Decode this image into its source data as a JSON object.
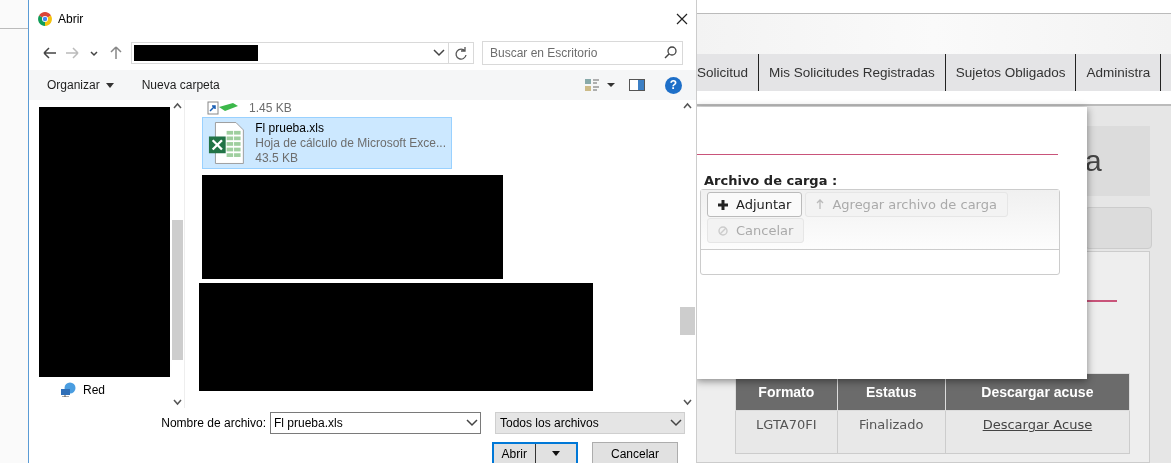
{
  "dialog": {
    "title": "Abrir",
    "search": {
      "placeholder": "Buscar en Escritorio"
    },
    "toolbar": [
      {
        "label": "Organizar",
        "kind": "menu"
      },
      {
        "label": "Nueva carpeta",
        "kind": "button"
      }
    ],
    "help": "?",
    "nav_pane": {
      "items": [
        {
          "label": "Red"
        }
      ]
    },
    "files": [
      {
        "kind": "shortcut",
        "size": "1.45 KB",
        "selected": false
      },
      {
        "kind": "excel",
        "name": "Fl prueba.xls",
        "type": "Hoja de cálculo de Microsoft Exce...",
        "size": "43.5 KB",
        "selected": true
      }
    ],
    "file_name_label": "Nombre de archivo:",
    "file_name": "Fl prueba.xls",
    "file_type": "Todos los archivos",
    "buttons": [
      {
        "label": "Abrir",
        "kind": "split"
      },
      {
        "label": "Cancelar",
        "kind": "plain"
      }
    ]
  },
  "page": {
    "nav_tabs": [
      "Solicitud",
      "Mis Solicitudes Registradas",
      "Sujetos Obligados",
      "Administra"
    ],
    "title_fragment": "a",
    "table": {
      "columns": [
        "Formato",
        "Estatus",
        "Descargar acuse"
      ],
      "rows": [
        {
          "cells": [
            {
              "text": "LGTA70FI",
              "kind": "text"
            },
            {
              "text": "Finalizado",
              "kind": "text"
            },
            {
              "text": "Descargar Acuse",
              "kind": "link"
            }
          ]
        }
      ]
    },
    "modal": {
      "label": "Archivo de carga :",
      "buttons": [
        {
          "label": "Adjuntar",
          "kind": "plus",
          "disabled": false
        },
        {
          "label": "Agregar archivo de carga",
          "kind": "upload",
          "disabled": true
        },
        {
          "label": "Cancelar",
          "kind": "ban",
          "disabled": true
        }
      ]
    }
  }
}
